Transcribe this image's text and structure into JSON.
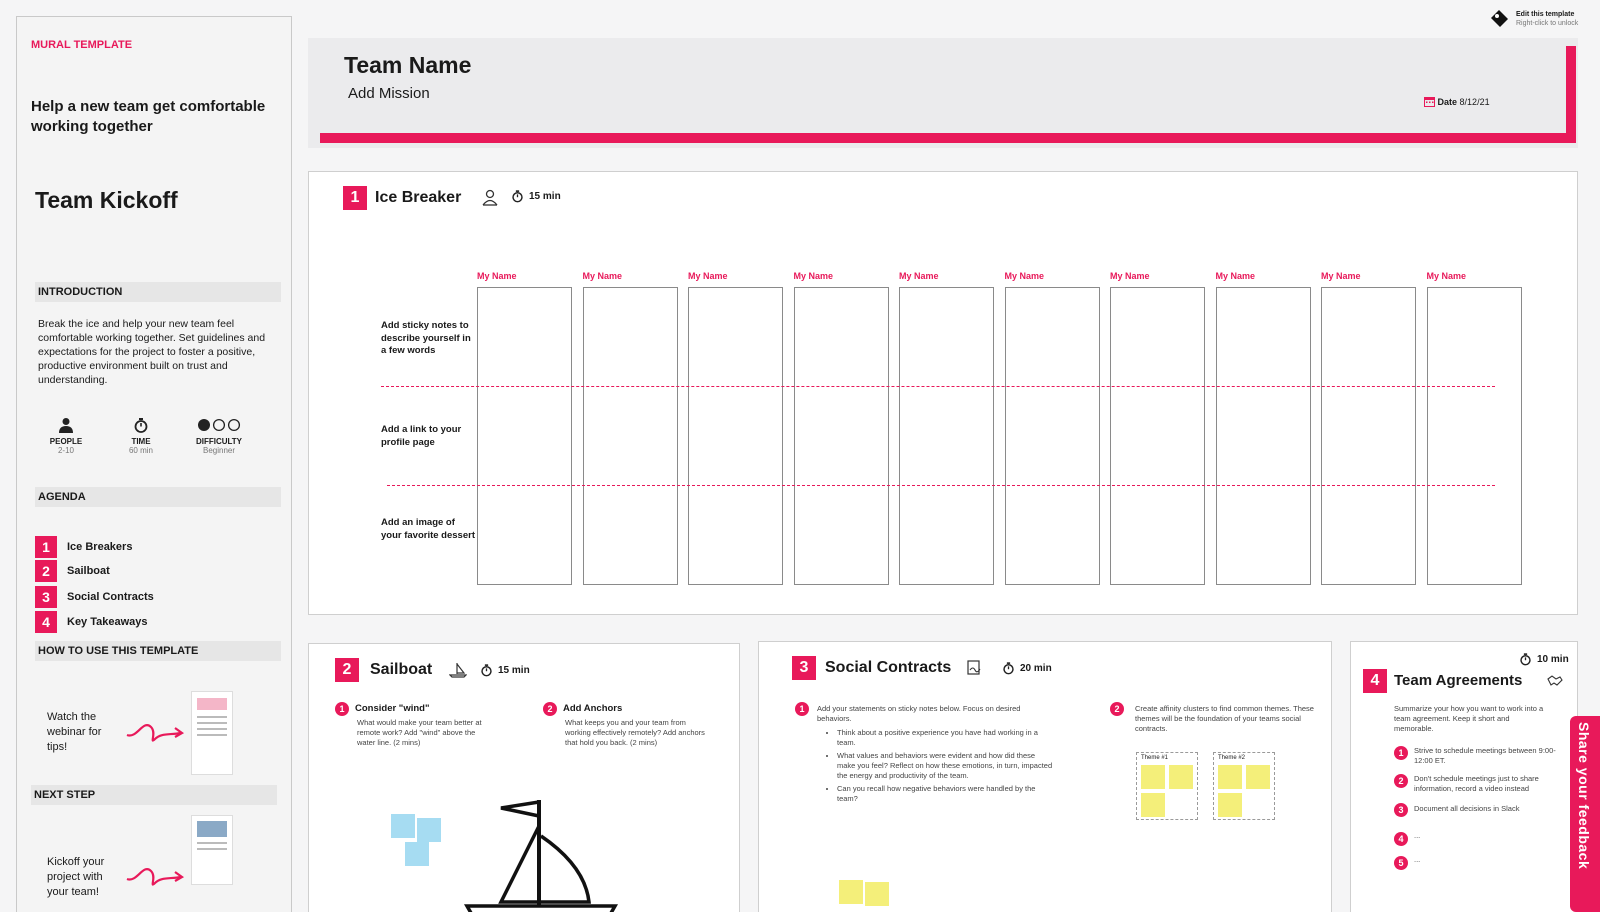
{
  "sidebar": {
    "template_label": "MURAL TEMPLATE",
    "tagline": "Help a new team get comfortable working together",
    "title": "Team Kickoff",
    "intro_heading": "INTRODUCTION",
    "intro_text": "Break the ice and help your new team feel comfortable working together. Set guidelines and expectations for the project to foster a positive, productive environment built on trust and understanding.",
    "stats": [
      {
        "label": "PEOPLE",
        "value": "2-10",
        "icon": "person-icon"
      },
      {
        "label": "TIME",
        "value": "60 min",
        "icon": "stopwatch-icon"
      },
      {
        "label": "DIFFICULTY",
        "value": "Beginner",
        "icon": "difficulty-dots-icon",
        "level": 1,
        "level_max": 3
      }
    ],
    "agenda_heading": "AGENDA",
    "agenda": [
      {
        "num": "1",
        "label": "Ice Breakers"
      },
      {
        "num": "2",
        "label": "Sailboat"
      },
      {
        "num": "3",
        "label": "Social Contracts"
      },
      {
        "num": "4",
        "label": "Key Takeaways"
      }
    ],
    "howto_heading": "HOW TO USE THIS TEMPLATE",
    "howto_text": "Watch the webinar for tips!",
    "next_heading": "NEXT STEP",
    "next_text": "Kickoff your project with your team!"
  },
  "header": {
    "team_name": "Team Name",
    "mission": "Add Mission",
    "date_label": "Date",
    "date_value": "8/12/21"
  },
  "top_right": {
    "edit_label": "Edit this template",
    "edit_hint": "Right-click to unlock"
  },
  "icebreaker": {
    "num": "1",
    "title": "Ice Breaker",
    "time": "15 min",
    "column_label": "My Name",
    "column_count": 10,
    "rows": [
      "Add sticky notes to describe yourself in a few words",
      "Add a link to your profile page",
      "Add an image of your favorite dessert"
    ]
  },
  "sailboat": {
    "num": "2",
    "title": "Sailboat",
    "time": "15 min",
    "steps": [
      {
        "num": "1",
        "title": "Consider \"wind\"",
        "text": "What would make your team better at remote work? Add \"wind\" above the water line. (2 mins)"
      },
      {
        "num": "2",
        "title": "Add Anchors",
        "text": "What keeps you and your team from working effectively remotely? Add anchors that hold you back. (2 mins)"
      }
    ]
  },
  "social": {
    "num": "3",
    "title": "Social Contracts",
    "time": "20 min",
    "step1": "Add your statements on sticky notes below. Focus on desired behaviors.",
    "bullets": [
      "Think about a positive experience you have had working in a team.",
      "What values and behaviors were evident and how did these make you feel? Reflect on how these emotions, in turn, impacted the energy and productivity of the team.",
      "Can you recall how negative behaviors were handled by the team?"
    ],
    "step2": "Create affinity clusters to find common themes. These themes will be the foundation of your teams social contracts.",
    "themes": [
      "Theme #1",
      "Theme #2"
    ]
  },
  "agreements": {
    "num": "4",
    "title": "Team Agreements",
    "time": "10 min",
    "intro": "Summarize your how you want to work into a team agreement. Keep it short and memorable.",
    "items": [
      {
        "num": "1",
        "text": "Strive to schedule meetings between 9:00-12:00 ET."
      },
      {
        "num": "2",
        "text": "Don't schedule meetings just to share information, record a video instead"
      },
      {
        "num": "3",
        "text": "Document all decisions in Slack"
      },
      {
        "num": "4",
        "text": "..."
      },
      {
        "num": "5",
        "text": "..."
      }
    ]
  },
  "feedback_tab": "Share your feedback",
  "colors": {
    "accent": "#e8195a",
    "sticky_blue": "#a6dcf2",
    "sticky_yellow": "#f4ef7a"
  }
}
